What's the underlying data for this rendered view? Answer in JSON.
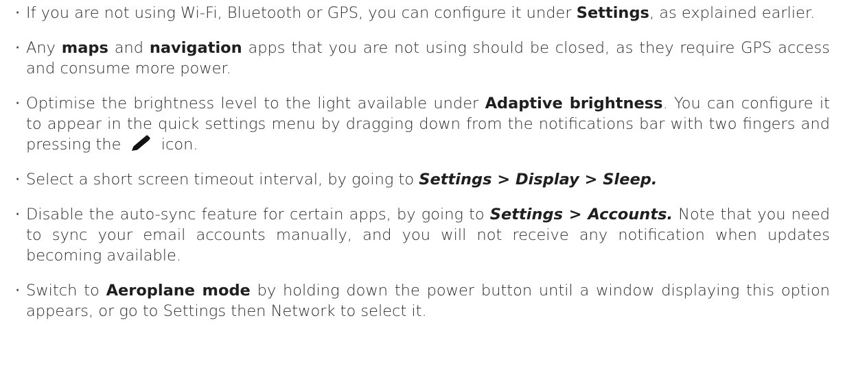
{
  "tips": [
    {
      "t1": "If you are not using Wi-Fi, Bluetooth or GPS, you can configure it under ",
      "b1": "Settings",
      "t2": ", as explained earlier."
    },
    {
      "t1": "Any ",
      "b1": "maps",
      "t2": " and ",
      "b2": "navigation",
      "t3": " apps that you are not using should be closed, as they require GPS access and consume more power."
    },
    {
      "t1": "Optimise the brightness level to the light available under ",
      "b1": "Adaptive brightness",
      "t2": ". You can configure it to appear in the quick settings menu by dragging down from the notifications bar with two fingers and pressing the ",
      "icon": "pencil-icon",
      "t3": " icon."
    },
    {
      "t1": "Select a short screen timeout interval, by going to ",
      "path": "Settings > Display > Sleep."
    },
    {
      "t1": "Disable the auto-sync feature for certain apps, by going to ",
      "path": "Settings > Accounts.",
      "t2": " Note that you need to sync your email accounts manually, and you will not receive any notification when updates becoming available."
    },
    {
      "t1": "Switch to ",
      "b1": "Aeroplane mode",
      "t2": " by holding down the power button until a window displaying this option appears, or go to Settings then Network to select it."
    }
  ]
}
